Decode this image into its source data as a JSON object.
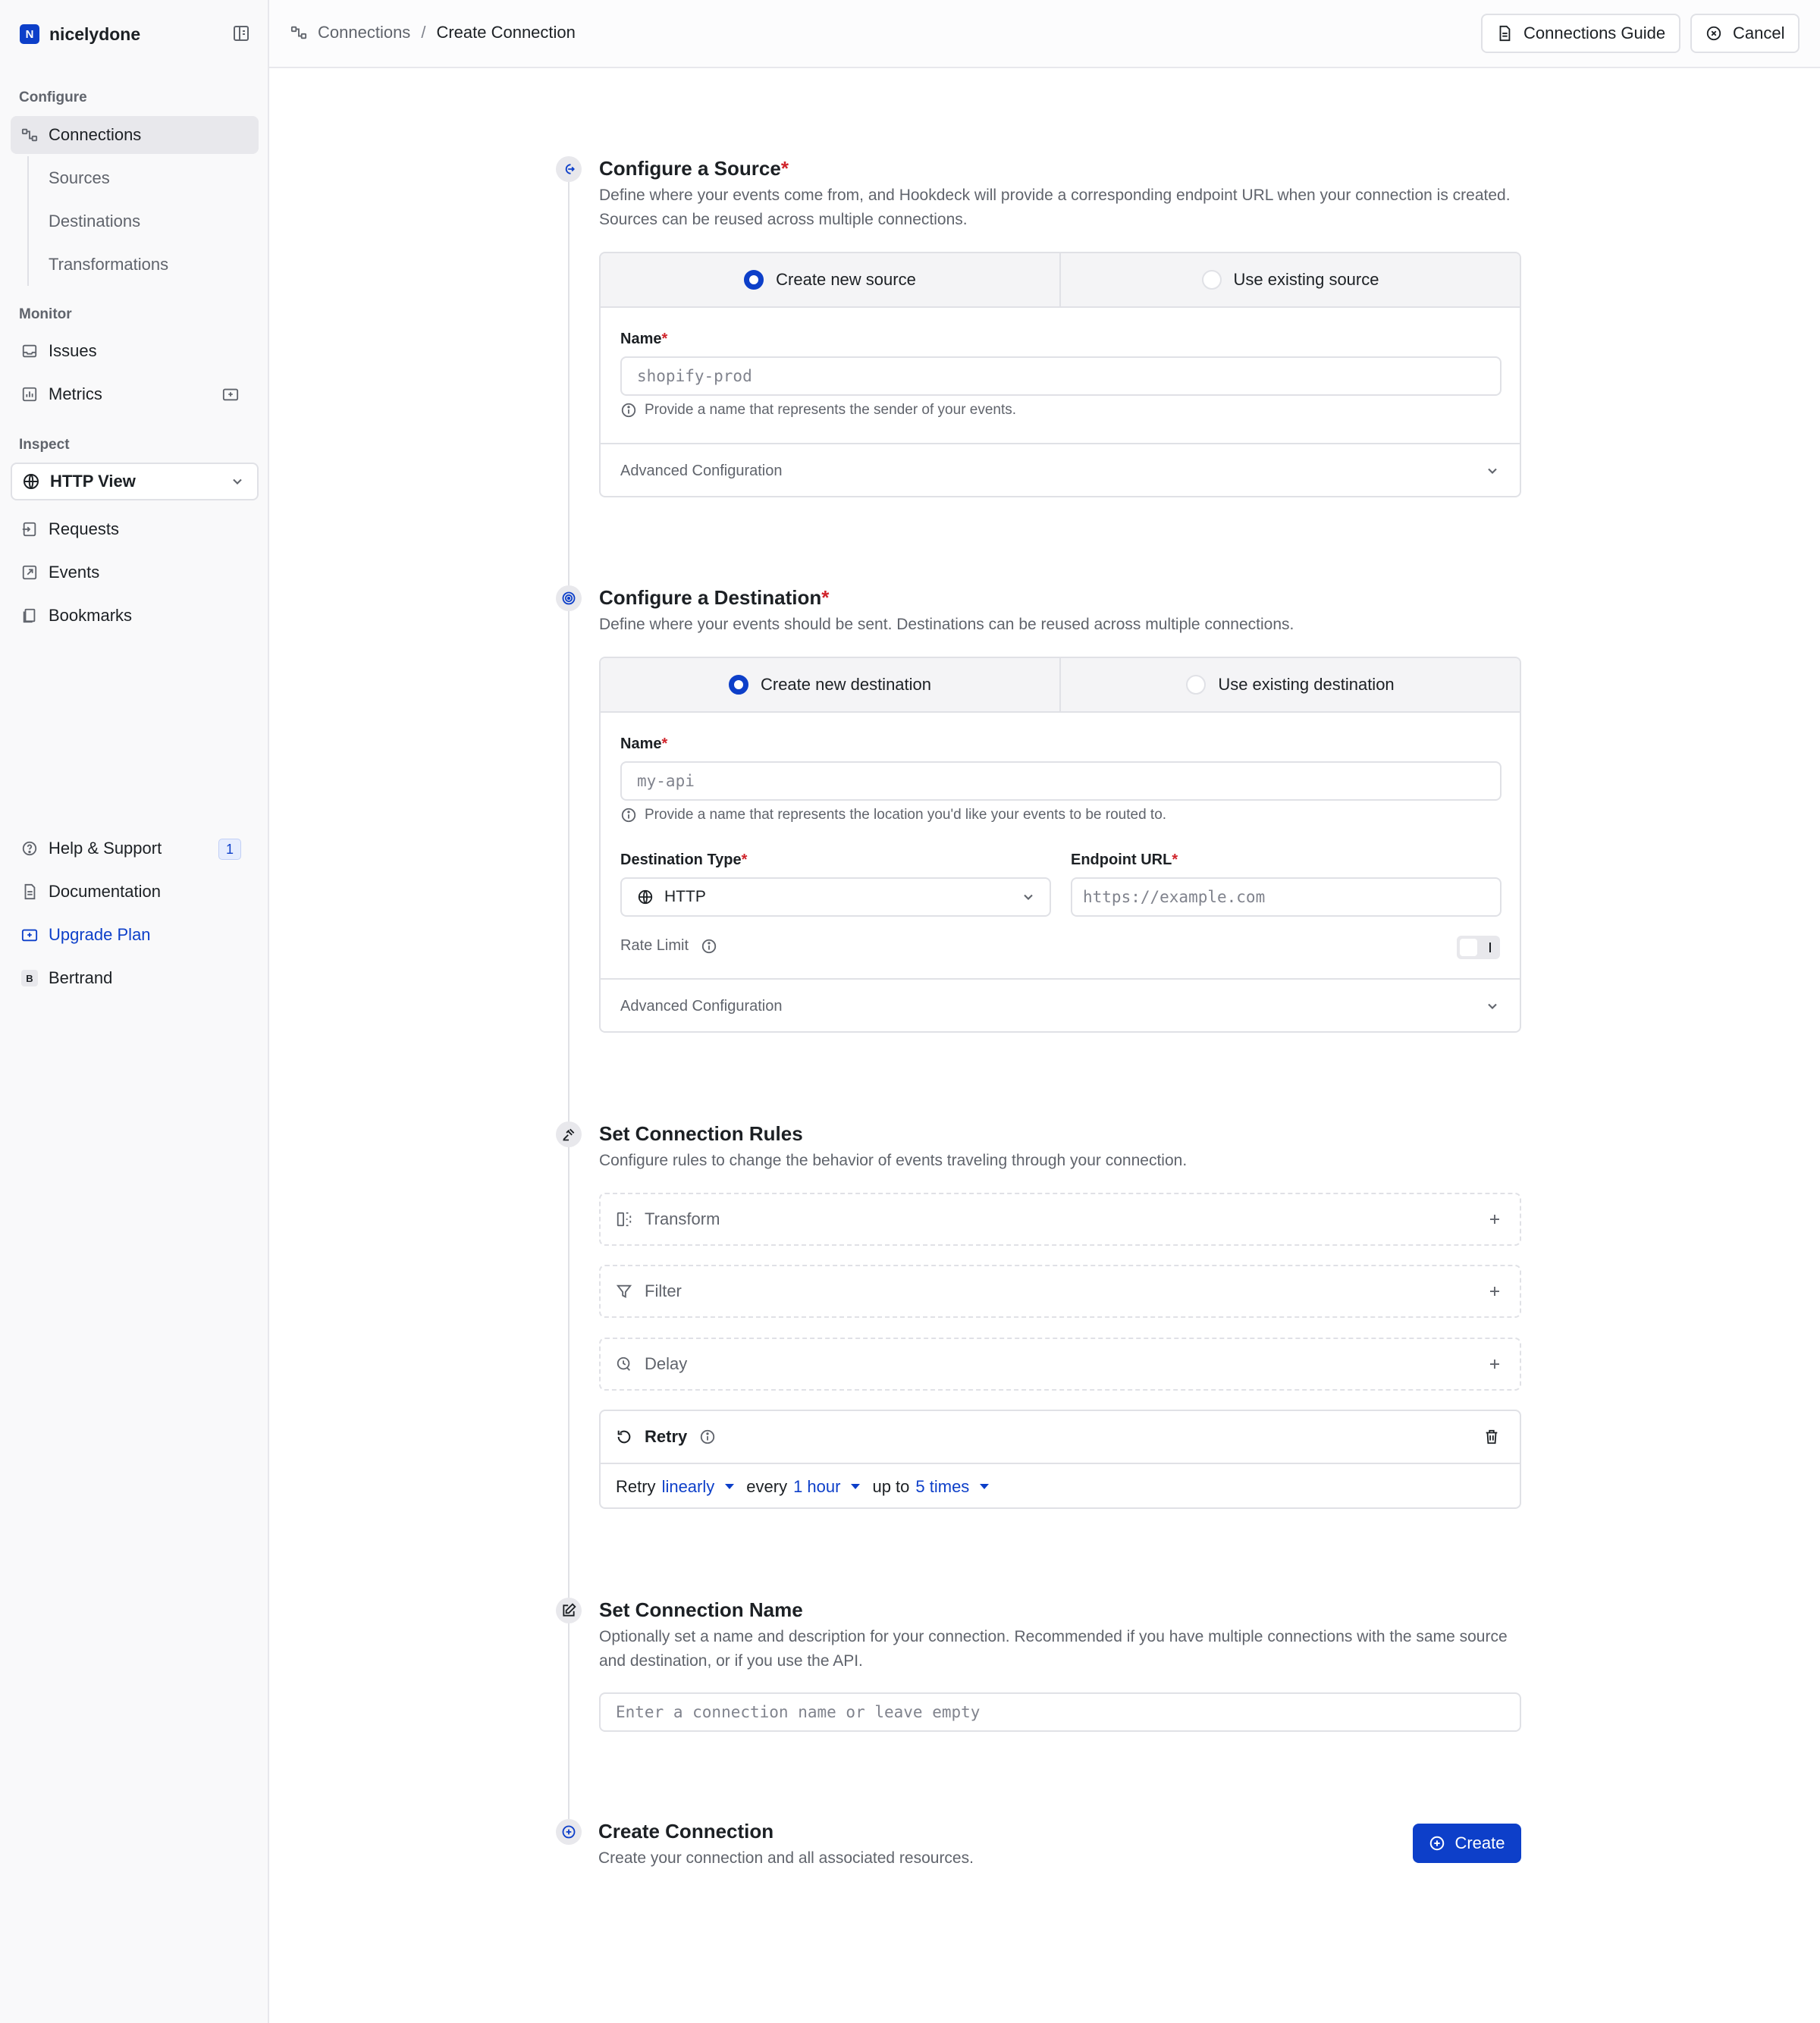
{
  "org": {
    "badge": "N",
    "name": "nicelydone"
  },
  "sidebar": {
    "configure_label": "Configure",
    "monitor_label": "Monitor",
    "inspect_label": "Inspect",
    "connections": "Connections",
    "sources": "Sources",
    "destinations": "Destinations",
    "transformations": "Transformations",
    "issues": "Issues",
    "metrics": "Metrics",
    "http_view": "HTTP View",
    "requests": "Requests",
    "events": "Events",
    "bookmarks": "Bookmarks",
    "help": "Help & Support",
    "help_count": "1",
    "documentation": "Documentation",
    "upgrade": "Upgrade Plan",
    "user_initial": "B",
    "user_name": "Bertrand"
  },
  "header": {
    "crumb_root": "Connections",
    "crumb_sep": "/",
    "crumb_current": "Create Connection",
    "guide_button": "Connections Guide",
    "cancel_button": "Cancel"
  },
  "source": {
    "title": "Configure a Source",
    "required_mark": "*",
    "description": "Define where your events come from, and Hookdeck will provide a corresponding endpoint URL when your connection is created. Sources can be reused across multiple connections.",
    "tab_new": "Create new source",
    "tab_existing": "Use existing source",
    "name_label": "Name",
    "name_placeholder": "shopify-prod",
    "name_hint": "Provide a name that represents the sender of your events.",
    "advanced": "Advanced Configuration"
  },
  "destination": {
    "title": "Configure a Destination",
    "required_mark": "*",
    "description": "Define where your events should be sent. Destinations can be reused across multiple connections.",
    "tab_new": "Create new destination",
    "tab_existing": "Use existing destination",
    "name_label": "Name",
    "name_placeholder": "my-api",
    "name_hint": "Provide a name that represents the location you'd like your events to be routed to.",
    "type_label": "Destination Type",
    "type_value": "HTTP",
    "url_label": "Endpoint URL",
    "url_placeholder": "https://example.com",
    "rate_limit": "Rate Limit",
    "advanced": "Advanced Configuration"
  },
  "rules": {
    "title": "Set Connection Rules",
    "description": "Configure rules to change the behavior of events traveling through your connection.",
    "transform": "Transform",
    "filter": "Filter",
    "delay": "Delay",
    "retry": "Retry",
    "retry_prefix": "Retry",
    "retry_strategy": "linearly",
    "retry_every": "every",
    "retry_interval": "1 hour",
    "retry_upto": "up to",
    "retry_count": "5 times"
  },
  "name_step": {
    "title": "Set Connection Name",
    "description": "Optionally set a name and description for your connection. Recommended if you have multiple connections with the same source and destination, or if you use the API.",
    "placeholder": "Enter a connection name or leave empty"
  },
  "create_step": {
    "title": "Create Connection",
    "description": "Create your connection and all associated resources.",
    "button": "Create"
  }
}
